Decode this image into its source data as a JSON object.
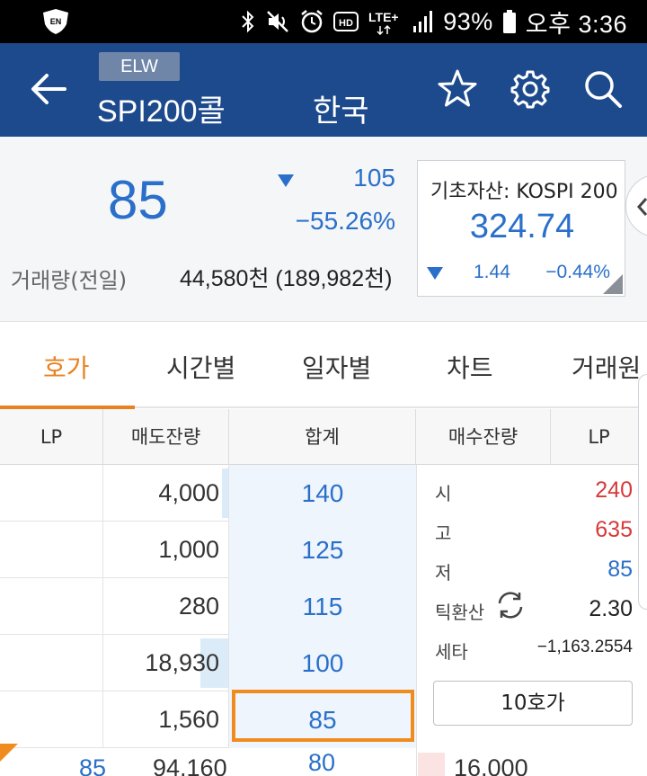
{
  "status_bar": {
    "battery": "93%",
    "time": "오후 3:36",
    "network": "LTE+",
    "hd": "HD",
    "app_badge": "EN",
    "icons": [
      "bluetooth-icon",
      "mute-icon",
      "alarm-icon",
      "hd-icon",
      "lte-icon",
      "signal-icon",
      "battery-icon"
    ]
  },
  "header": {
    "badge": "ELW",
    "title": "SPI200콜",
    "market": "한국",
    "icons": [
      "back-arrow-icon",
      "star-icon",
      "gear-icon",
      "search-icon"
    ]
  },
  "price": {
    "current": "85",
    "change": "105",
    "change_pct": "−55.26%",
    "volume_label": "거래량(전일)",
    "volume_value": "44,580천 (189,982천)"
  },
  "underlying": {
    "label": "기초자산: KOSPI 200",
    "price": "324.74",
    "change": "1.44",
    "change_pct": "−0.44%"
  },
  "tabs": [
    {
      "label": "호가",
      "active": true
    },
    {
      "label": "시간별",
      "active": false
    },
    {
      "label": "일자별",
      "active": false
    },
    {
      "label": "차트",
      "active": false
    },
    {
      "label": "거래원",
      "active": false
    }
  ],
  "table_header": [
    "LP",
    "매도잔량",
    "합계",
    "매수잔량",
    "LP"
  ],
  "order_book": {
    "rows": [
      {
        "lp": "",
        "sell_qty": "4,000",
        "price": "140",
        "bar": 0.05
      },
      {
        "lp": "",
        "sell_qty": "1,000",
        "price": "125",
        "bar": 0.0
      },
      {
        "lp": "",
        "sell_qty": "280",
        "price": "115",
        "bar": 0.0
      },
      {
        "lp": "",
        "sell_qty": "18,930",
        "price": "100",
        "bar": 0.22
      },
      {
        "lp": "",
        "sell_qty": "1,560",
        "price": "85",
        "bar": 0.0
      }
    ],
    "partial_row": {
      "lp": "85",
      "sell_qty": "94,160",
      "price": "80",
      "buy_qty": "16,000"
    }
  },
  "info": {
    "open_label": "시",
    "open_value": "240",
    "high_label": "고",
    "high_value": "635",
    "low_label": "저",
    "low_value": "85",
    "tick_label": "틱환산",
    "tick_value": "2.30",
    "theta_label": "세타",
    "theta_value": "−1,163.2554",
    "button_label": "10호가"
  },
  "colors": {
    "header_bg": "#1d4a8c",
    "accent_orange": "#e8811f",
    "down_blue": "#2a6fc9",
    "up_red": "#d63a3a"
  }
}
